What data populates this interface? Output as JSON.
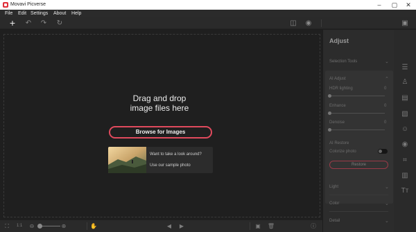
{
  "window": {
    "title": "Movavi Picverse"
  },
  "menu": [
    "File",
    "Edit",
    "Settings",
    "About",
    "Help"
  ],
  "canvas": {
    "drop_line1": "Drag and drop",
    "drop_line2": "image files here",
    "browse_label": "Browse for Images",
    "sample_line1": "Want to take a look around?",
    "sample_line2": "Use our sample photo"
  },
  "bottom": {
    "ratio_label": "1:1"
  },
  "panel": {
    "title": "Adjust",
    "selection_tools": "Selection Tools",
    "ai_adjust": "AI Adjust",
    "hdr_label": "HDR lighting",
    "hdr_value": "0",
    "enhance_label": "Enhance",
    "enhance_value": "0",
    "denoise_label": "Denoise",
    "denoise_value": "0",
    "ai_restore": "AI Restore",
    "colorize_label": "Colorize photo",
    "restore_label": "Restore",
    "light": "Light",
    "color": "Color",
    "detail": "Detail"
  },
  "accent_color": "#e14a5d"
}
